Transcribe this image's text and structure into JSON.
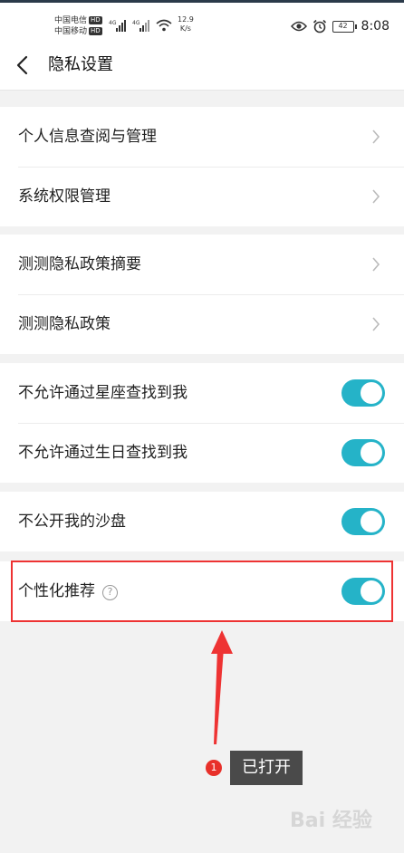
{
  "status_bar": {
    "carrier1": "中国电信",
    "carrier2": "中国移动",
    "hd": "HD",
    "network": "4G",
    "speed_value": "12.9",
    "speed_unit": "K/s",
    "battery": "42",
    "time": "8:08"
  },
  "nav": {
    "title": "隐私设置"
  },
  "groups": [
    {
      "rows": [
        {
          "label": "个人信息查阅与管理"
        },
        {
          "label": "系统权限管理"
        }
      ]
    },
    {
      "rows": [
        {
          "label": "测测隐私政策摘要"
        },
        {
          "label": "测测隐私政策"
        }
      ]
    },
    {
      "rows": [
        {
          "label": "不允许通过星座查找到我",
          "on": true
        },
        {
          "label": "不允许通过生日查找到我",
          "on": true
        }
      ]
    },
    {
      "rows": [
        {
          "label": "不公开我的沙盘",
          "on": true
        }
      ]
    },
    {
      "rows": [
        {
          "label": "个性化推荐",
          "help": "?",
          "on": true
        }
      ]
    }
  ],
  "annotation": {
    "badge": "1",
    "text": "已打开"
  },
  "watermark": "Bai 经验",
  "colors": {
    "toggle_on": "#25b3c8",
    "highlight": "#ee3333",
    "badge": "#e8302a"
  }
}
